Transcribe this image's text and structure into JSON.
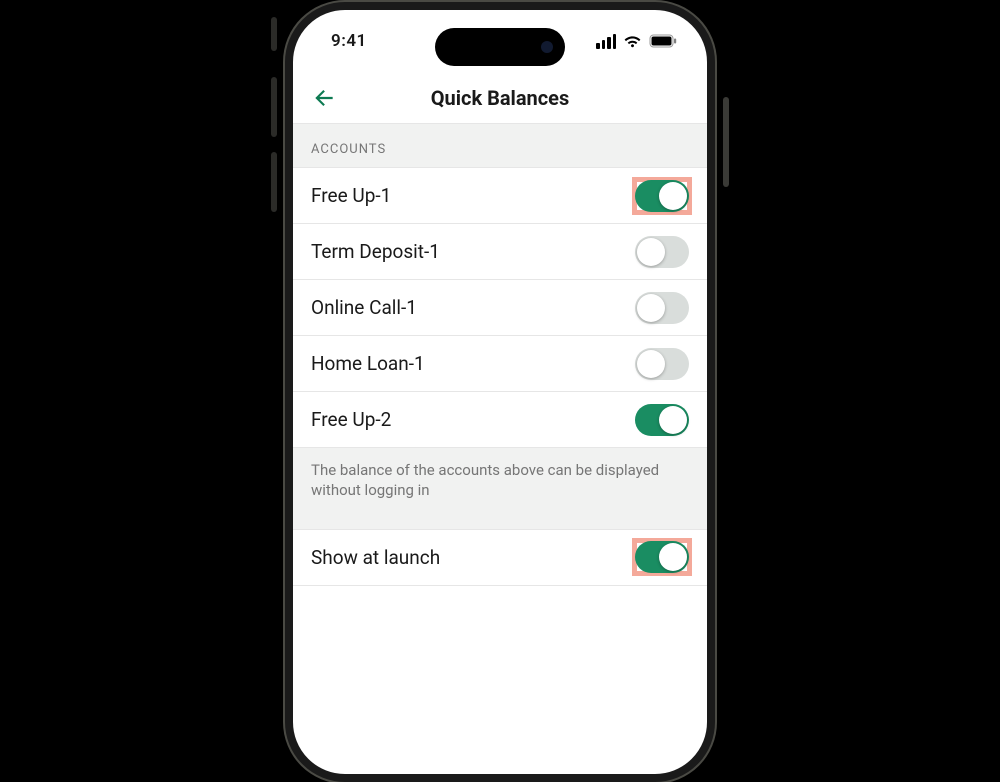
{
  "status": {
    "time": "9:41"
  },
  "header": {
    "title": "Quick Balances"
  },
  "section_label": "ACCOUNTS",
  "accounts": [
    {
      "label": "Free Up-1",
      "on": true,
      "highlight": true
    },
    {
      "label": "Term Deposit-1",
      "on": false,
      "highlight": false
    },
    {
      "label": "Online Call-1",
      "on": false,
      "highlight": false
    },
    {
      "label": "Home Loan-1",
      "on": false,
      "highlight": false
    },
    {
      "label": "Free Up-2",
      "on": true,
      "highlight": false
    }
  ],
  "caption": "The balance of the accounts above can be displayed without logging in",
  "launch_row": {
    "label": "Show at launch",
    "on": true,
    "highlight": true
  }
}
